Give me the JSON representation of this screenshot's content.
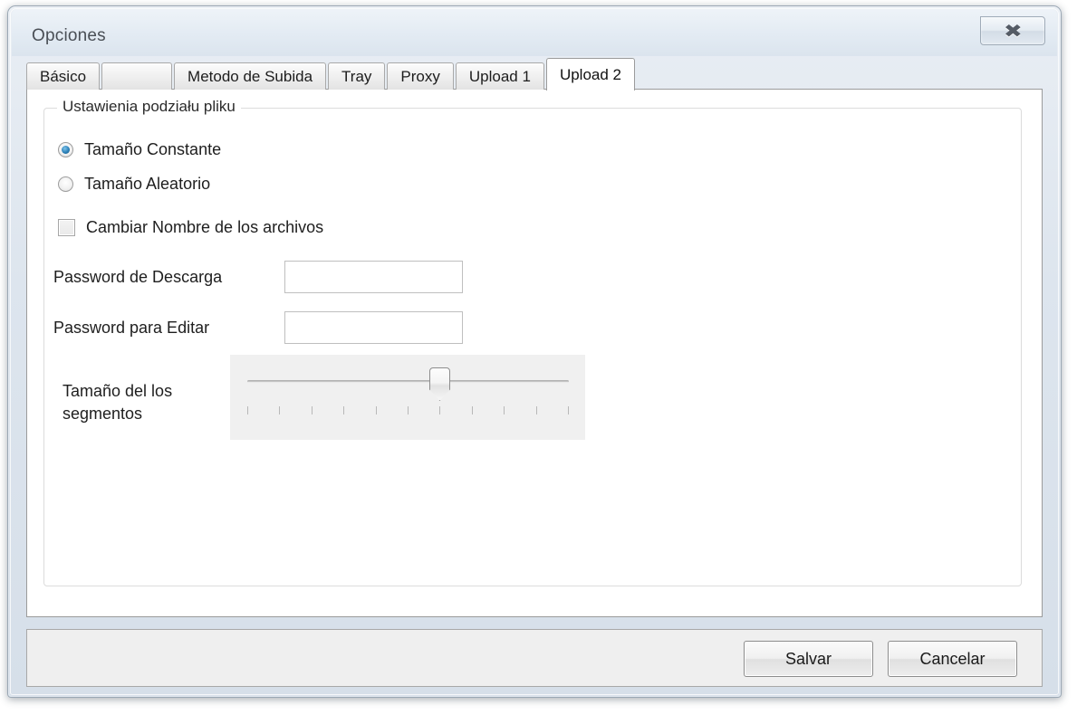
{
  "window": {
    "title": "Opciones",
    "close_icon": "close-x-icon",
    "close_glyph": "✖"
  },
  "tabs": [
    {
      "label": "Básico",
      "active": false
    },
    {
      "label": "",
      "active": false
    },
    {
      "label": "Metodo de Subida",
      "active": false
    },
    {
      "label": "Tray",
      "active": false
    },
    {
      "label": "Proxy",
      "active": false
    },
    {
      "label": "Upload 1",
      "active": false
    },
    {
      "label": "Upload 2",
      "active": true
    }
  ],
  "group": {
    "legend": "Ustawienia podziału pliku"
  },
  "radios": [
    {
      "label": "Tamaño Constante",
      "checked": true
    },
    {
      "label": "Tamaño Aleatorio",
      "checked": false
    }
  ],
  "checkbox": {
    "label": "Cambiar Nombre de los archivos",
    "checked": false
  },
  "fields": [
    {
      "label": "Password de Descarga",
      "value": "",
      "placeholder": ""
    },
    {
      "label": "Password para Editar",
      "value": "",
      "placeholder": ""
    }
  ],
  "slider": {
    "label": "Tamaño del los segmentos",
    "ticks": 11,
    "value_index": 6,
    "min_index": 0,
    "max_index": 10
  },
  "buttons": {
    "save_label": "Salvar",
    "cancel_label": "Cancelar"
  },
  "colors": {
    "accent": "#2b80b8",
    "window_frame": "#9aa7b4",
    "panel": "#f0f0f0",
    "content": "#ffffff"
  }
}
